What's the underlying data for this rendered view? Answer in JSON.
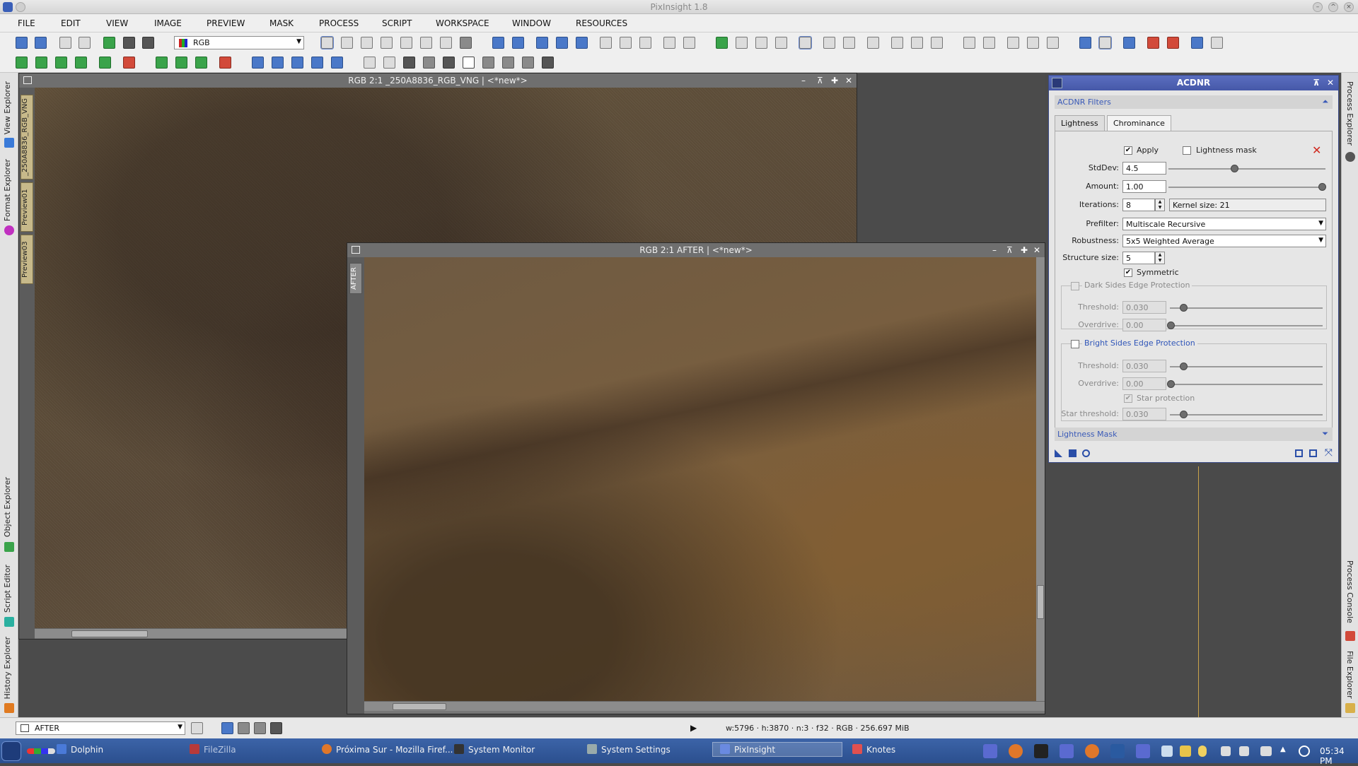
{
  "app": {
    "title": "PixInsight 1.8"
  },
  "menu": [
    "FILE",
    "EDIT",
    "VIEW",
    "IMAGE",
    "PREVIEW",
    "MASK",
    "PROCESS",
    "SCRIPT",
    "WORKSPACE",
    "WINDOW",
    "RESOURCES"
  ],
  "toolbar": {
    "color_mode": "RGB"
  },
  "left_dock": {
    "view_explorer": "View Explorer",
    "format_explorer": "Format Explorer",
    "object_explorer": "Object Explorer",
    "script_editor": "Script Editor",
    "history_explorer": "History Explorer"
  },
  "right_dock": {
    "process_explorer": "Process Explorer",
    "process_console": "Process Console",
    "file_explorer": "File Explorer"
  },
  "window1": {
    "title": "RGB 2:1 _250A8836_RGB_VNG | <*new*>",
    "tabs": [
      "_250A8836_RGB_VNG",
      "Preview01",
      "Preview03"
    ]
  },
  "window2": {
    "title": "RGB 2:1 AFTER | <*new*>",
    "tab": "AFTER"
  },
  "acdnr": {
    "title": "ACDNR",
    "section": "ACDNR Filters",
    "tabs": [
      "Lightness",
      "Chrominance"
    ],
    "apply_label": "Apply",
    "apply_checked": true,
    "lightness_mask_label": "Lightness mask",
    "lightness_mask_checked": false,
    "stddev_label": "StdDev:",
    "stddev": "4.5",
    "amount_label": "Amount:",
    "amount": "1.00",
    "iterations_label": "Iterations:",
    "iterations": "8",
    "kernel_size": "Kernel size: 21",
    "prefilter_label": "Prefilter:",
    "prefilter": "Multiscale Recursive",
    "robustness_label": "Robustness:",
    "robustness": "5x5 Weighted Average",
    "structure_size_label": "Structure size:",
    "structure_size": "5",
    "symmetric_label": "Symmetric",
    "symmetric_checked": true,
    "dark_edge": {
      "title": "Dark Sides Edge Protection",
      "threshold_label": "Threshold:",
      "threshold": "0.030",
      "overdrive_label": "Overdrive:",
      "overdrive": "0.00"
    },
    "bright_edge": {
      "title": "Bright Sides Edge Protection",
      "threshold_label": "Threshold:",
      "threshold": "0.030",
      "overdrive_label": "Overdrive:",
      "overdrive": "0.00",
      "star_protection_label": "Star protection",
      "star_threshold_label": "Star threshold:",
      "star_threshold": "0.030"
    },
    "lightness_mask_section": "Lightness Mask"
  },
  "status": {
    "view": "AFTER",
    "info": "w:5796 · h:3870 · n:3 · f32 · RGB · 256.697 MiB"
  },
  "taskbar": {
    "items": [
      "Dolphin",
      "FileZilla",
      "Próxima Sur - Mozilla Firef...",
      "System Monitor",
      "System Settings",
      "PixInsight",
      "Knotes"
    ],
    "clock": "05:34 PM"
  }
}
